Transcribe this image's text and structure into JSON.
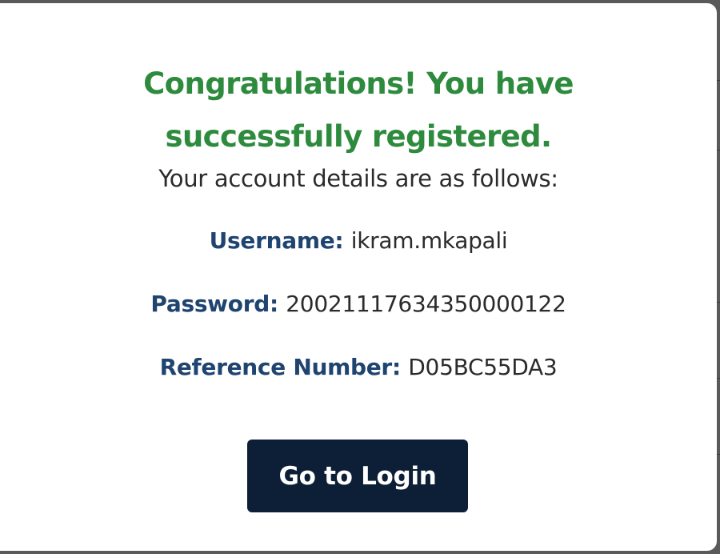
{
  "modal": {
    "title": "Congratulations! You have successfully registered.",
    "subtitle": "Your account details are as follows:",
    "details": {
      "username": {
        "label": "Username:",
        "value": "ikram.mkapali"
      },
      "password": {
        "label": "Password:",
        "value": "20021117634350000122"
      },
      "reference": {
        "label": "Reference Number:",
        "value": "D05BC55DA3"
      }
    },
    "login_button_label": "Go to Login"
  },
  "colors": {
    "title_green": "#2e8b3e",
    "label_blue": "#1f4470",
    "button_navy": "#0d1f36",
    "backdrop_gray": "#5a5a5a"
  }
}
